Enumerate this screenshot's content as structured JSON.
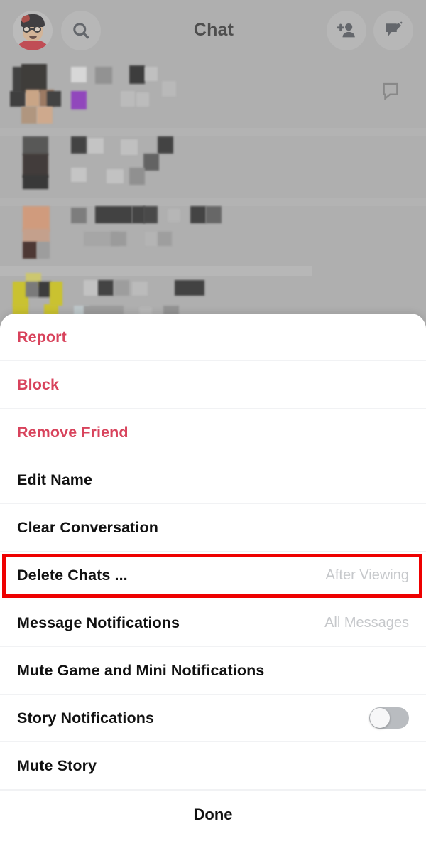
{
  "app": {
    "header": {
      "title": "Chat",
      "avatar_name": "bitmoji-avatar",
      "search_icon": "search-icon",
      "add_friend_icon": "add-friend-icon",
      "new_chat_icon": "new-chat-icon"
    },
    "chat_list": {
      "note": "blurred/pixelated chat conversation rows",
      "rows": [
        {
          "bubble_icon": "chat-bubble-icon"
        },
        {},
        {},
        {}
      ]
    }
  },
  "action_sheet": {
    "items": [
      {
        "label": "Report",
        "value": "",
        "style": "danger",
        "control": "none"
      },
      {
        "label": "Block",
        "value": "",
        "style": "danger",
        "control": "none"
      },
      {
        "label": "Remove Friend",
        "value": "",
        "style": "danger",
        "control": "none"
      },
      {
        "label": "Edit Name",
        "value": "",
        "style": "default",
        "control": "none"
      },
      {
        "label": "Clear Conversation",
        "value": "",
        "style": "default",
        "control": "none"
      },
      {
        "label": "Delete Chats ...",
        "value": "After Viewing",
        "style": "default",
        "control": "value",
        "highlighted": true
      },
      {
        "label": "Message Notifications",
        "value": "All Messages",
        "style": "default",
        "control": "value"
      },
      {
        "label": "Mute Game and Mini Notifications",
        "value": "",
        "style": "default",
        "control": "none"
      },
      {
        "label": "Story Notifications",
        "value": "",
        "style": "default",
        "control": "toggle",
        "toggle_on": false
      },
      {
        "label": "Mute Story",
        "value": "",
        "style": "default",
        "control": "none"
      }
    ],
    "done_label": "Done"
  },
  "colors": {
    "danger_text": "#d8435c",
    "value_text": "#c6c8cb",
    "label_text": "#111111",
    "sheet_background": "#ffffff",
    "app_background": "#b6b6b6",
    "highlight_border": "#ee0000",
    "toggle_track_off": "#b9bcc0"
  }
}
